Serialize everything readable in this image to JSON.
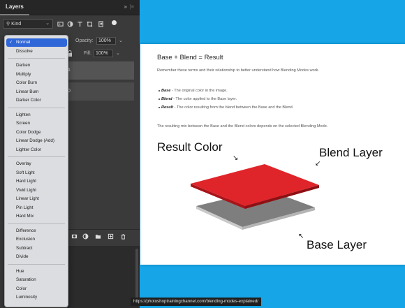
{
  "layers_panel": {
    "tab_label": "Layers",
    "collapse_label": "»",
    "filter_kind": "Kind",
    "opacity_label": "Opacity:",
    "opacity_value": "100%",
    "fill_label": "Fill:",
    "fill_value": "100%",
    "layer_fragments": [
      "1",
      "0"
    ]
  },
  "blend_menu": {
    "selected": "Normal",
    "groups": [
      [
        "Normal",
        "Dissolve"
      ],
      [
        "Darken",
        "Multiply",
        "Color Burn",
        "Linear Burn",
        "Darker Color"
      ],
      [
        "Lighten",
        "Screen",
        "Color Dodge",
        "Linear Dodge (Add)",
        "Lighter Color"
      ],
      [
        "Overlay",
        "Soft Light",
        "Hard Light",
        "Vivid Light",
        "Linear Light",
        "Pin Light",
        "Hard Mix"
      ],
      [
        "Difference",
        "Exclusion",
        "Subtract",
        "Divide"
      ],
      [
        "Hue",
        "Saturation",
        "Color",
        "Luminosity"
      ]
    ]
  },
  "article": {
    "title": "Base + Blend = Result",
    "intro": "Remember these terms and their relationship to better understand how Blending Modes work.",
    "bullets": [
      {
        "term": "Base",
        "text": " - The original color in the image."
      },
      {
        "term": "Blend",
        "text": " - The color applied to the Base layer."
      },
      {
        "term": "Result",
        "text": " - The color resulting from the blend between the Base and the Blend."
      }
    ],
    "mix_note": "The resulting mix between the Base and the Blend colors depends on the selected Blending Mode.",
    "diagram_labels": {
      "result": "Result Color",
      "blend": "Blend Layer",
      "base": "Base Layer"
    }
  },
  "source_url": "https://photoshoptrainingchannel.com/blending-modes-explained/",
  "colors": {
    "background": "#16a6e8",
    "panel": "#3a3a3a",
    "menu_bg": "#dcdde0",
    "menu_selection": "#2f66d8",
    "blend_layer": "#e0252a",
    "base_layer": "#8a8a8a"
  },
  "icons": [
    "search-icon",
    "image-filter-icon",
    "adjustment-filter-icon",
    "type-filter-icon",
    "shape-filter-icon",
    "smart-object-filter-icon",
    "lock-icon",
    "link-icon",
    "fx-icon",
    "mask-icon",
    "adjustment-icon",
    "folder-icon",
    "new-layer-icon",
    "trash-icon",
    "check-icon"
  ]
}
